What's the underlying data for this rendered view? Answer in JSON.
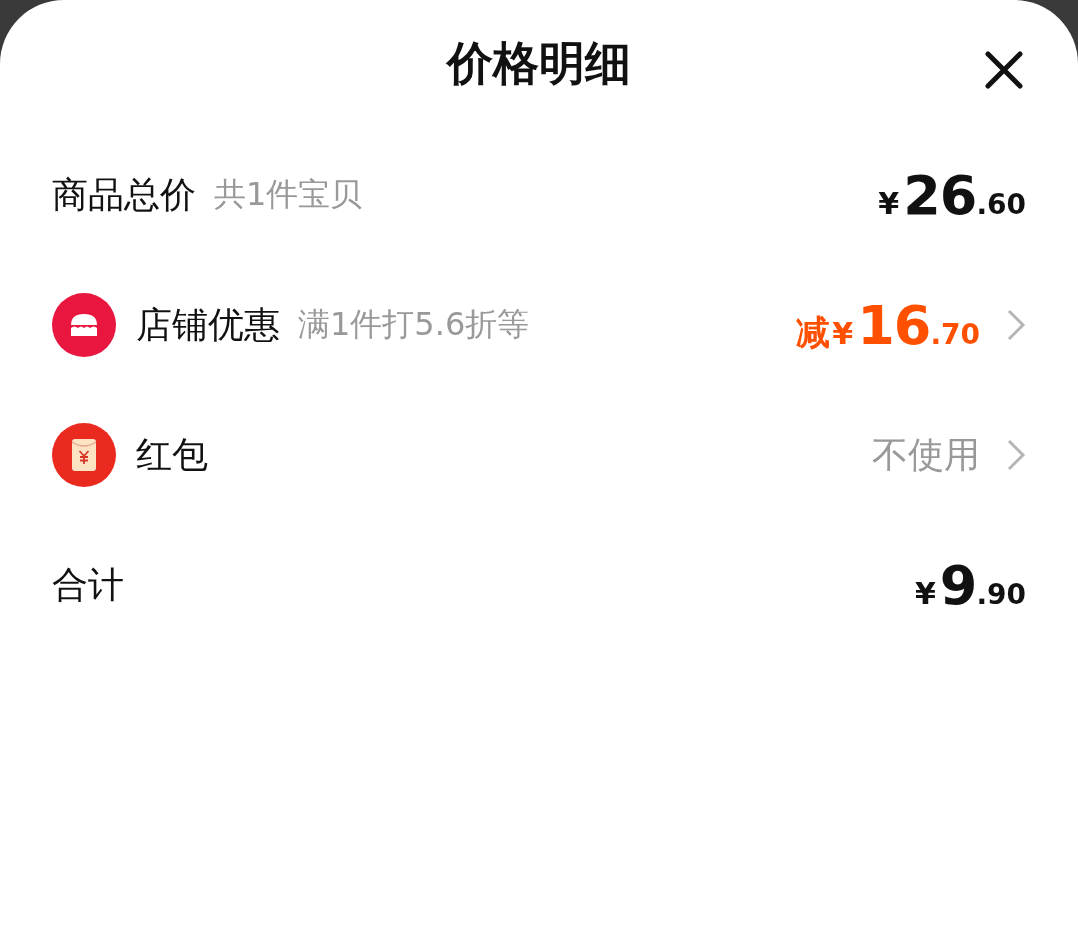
{
  "title": "价格明细",
  "rows": [
    {
      "kind": "price",
      "label": "商品总价",
      "note": "共1件宝贝",
      "price": {
        "currency": "¥",
        "integer": "26",
        "decimal": ".60"
      }
    },
    {
      "kind": "discount",
      "label": "店铺优惠",
      "note": "满1件打5.6折等",
      "price": {
        "prefix": "减",
        "currency": "¥",
        "integer": "16",
        "decimal": ".70"
      }
    },
    {
      "kind": "option",
      "label": "红包",
      "value": "不使用"
    },
    {
      "kind": "price",
      "label": "合计",
      "price": {
        "currency": "¥",
        "integer": "9",
        "decimal": ".90"
      }
    }
  ]
}
